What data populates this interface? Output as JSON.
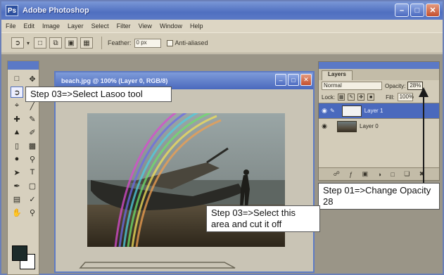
{
  "window": {
    "title": "Adobe Photoshop",
    "app_icon": "Ps"
  },
  "menu": [
    "File",
    "Edit",
    "Image",
    "Layer",
    "Select",
    "Filter",
    "View",
    "Window",
    "Help"
  ],
  "options_bar": {
    "feather_label": "Feather:",
    "feather_value": "0 px",
    "anti_alias_label": "Anti-aliased"
  },
  "document": {
    "title": "beach.jpg @ 100% (Layer 0, RGB/8)"
  },
  "layers_panel": {
    "tab_label": "Layers",
    "blend_mode": "Normal",
    "opacity_label": "Opacity:",
    "opacity_value": "28%",
    "lock_label": "Lock:",
    "fill_label": "Fill:",
    "fill_value": "100%",
    "layers": [
      {
        "name": "Layer 1",
        "selected": true
      },
      {
        "name": "Layer 0",
        "selected": false
      }
    ]
  },
  "annotations": {
    "lasso": "Step 03=>Select Lasoo tool",
    "opacity": "Step 01=>Change Opacity 28",
    "area": "Step 03=>Select this area and cut it off"
  },
  "colors": {
    "title_bar": "#4f6fc0",
    "foreground": "#1c2b2a",
    "background": "#ffffff"
  }
}
